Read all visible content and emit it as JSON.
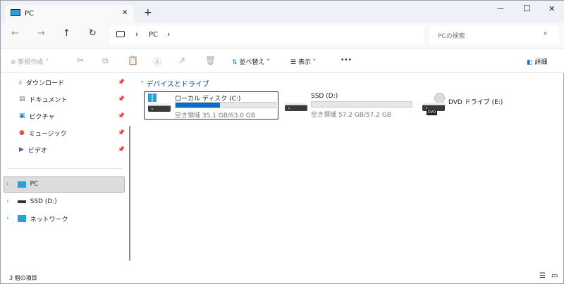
{
  "window": {
    "tab_title": "PC",
    "new_tab": "+",
    "minimize": "—",
    "maximize": "☐",
    "close": "✕"
  },
  "address": {
    "breadcrumb": [
      "PC"
    ],
    "sep": "›",
    "search_placeholder": "PCの検索"
  },
  "toolbar": {
    "new": "新規作成",
    "sort": "並べ替え",
    "view": "表示",
    "more": "•••",
    "details": "詳細"
  },
  "sidebar": {
    "quick": [
      {
        "label": "ダウンロード",
        "icon": "download-icon"
      },
      {
        "label": "ドキュメント",
        "icon": "document-icon"
      },
      {
        "label": "ピクチャ",
        "icon": "picture-icon"
      },
      {
        "label": "ミュージック",
        "icon": "music-icon"
      },
      {
        "label": "ビデオ",
        "icon": "video-icon"
      }
    ],
    "tree": [
      {
        "label": "PC",
        "selected": true
      },
      {
        "label": "SSD (D:)"
      },
      {
        "label": "ネットワーク"
      }
    ]
  },
  "main": {
    "group": "デバイスとドライブ",
    "drives": [
      {
        "name": "ローカル ディスク (C:)",
        "free": "空き領域 35.1 GB/63.0 GB",
        "used_fraction": 0.443
      },
      {
        "name": "SSD (D:)",
        "free": "空き領域 57.2 GB/57.2 GB",
        "used_fraction": 0
      },
      {
        "name": "DVD ドライブ (E:)",
        "badge": "DVD"
      }
    ]
  },
  "status": {
    "count": "3 個の項目"
  },
  "colors": {
    "accent": "#0a6ec9"
  }
}
